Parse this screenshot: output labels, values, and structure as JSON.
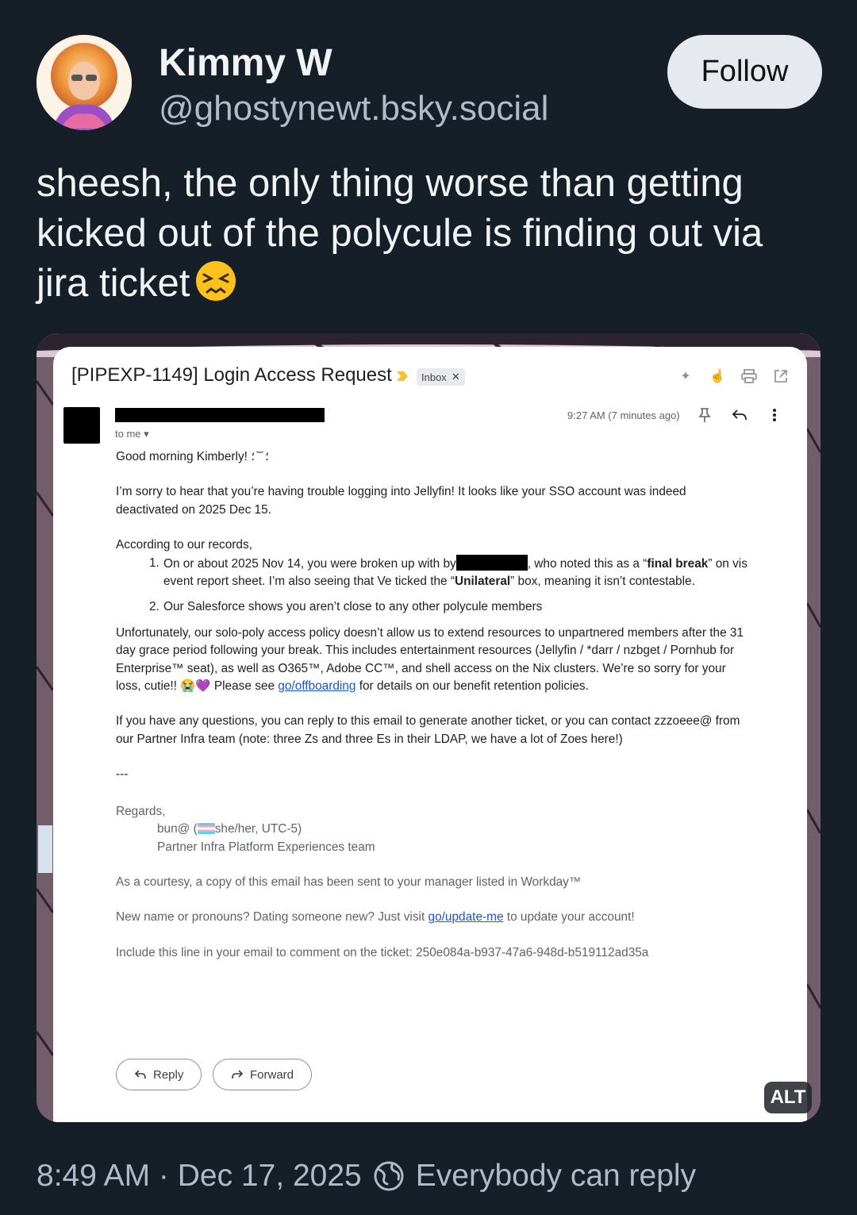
{
  "author": {
    "name": "Kimmy W",
    "handle": "@ghostynewt.bsky.social"
  },
  "follow_label": "Follow",
  "post_text": "sheesh, the only thing worse than getting kicked out of the polycule is finding out via jira ticket",
  "post_emoji": "persevering-face-emoji",
  "email": {
    "subject": "[PIPEXP-1149] Login Access Request",
    "label_chip": "Inbox",
    "to_me": "to me",
    "timestamp": "9:27 AM (7 minutes ago)",
    "greeting": "Good morning Kimberly! ؛ ᷄ ᷅ ؛",
    "p1": "I’m sorry to hear that you’re having trouble logging into Jellyfin! It looks like your SSO account was indeed deactivated on 2025 Dec 15.",
    "records_intro": "According to our records,",
    "item1": {
      "num": "1.",
      "a": "On or about 2025 Nov 14, you were broken up with by",
      "b": ", who noted this as a “",
      "bold1": "final break",
      "c": "” on vis event report sheet. I’m also seeing that Ve ticked the “",
      "bold2": "Unilateral",
      "d": "” box, meaning it isn’t contestable."
    },
    "item2": {
      "num": "2.",
      "text": "Our Salesforce shows you aren’t close to any other polycule members"
    },
    "p2_a": "Unfortunately, our solo-poly access policy doesn’t allow us to extend resources to unpartnered members after the 31 day grace period following your break. This includes entertainment resources (Jellyfin / *darr / nzbget / Pornhub for Enterprise™ seat), as well as O365™, Adobe CC™, and shell access on the Nix clusters. We’re so sorry for your loss, cutie!! 😭💜 Please see ",
    "p2_link": "go/offboarding",
    "p2_b": " for details on our benefit retention policies.",
    "p3": "If you have any questions, you can reply to this email to generate another ticket, or you can contact zzzoeee@ from our Partner Infra team (note: three Zs and three Es in their LDAP, we have a lot of Zoes here!)",
    "separator": "---",
    "regards": "Regards,",
    "sig_a": "bun@ (",
    "sig_b": "she/her, UTC-5)",
    "sig_team": "Partner Infra Platform Experiences team",
    "courtesy": "As a courtesy, a copy of this email has been sent to your manager listed in Workday™",
    "update_a": "New name or pronouns? Dating someone new? Just visit ",
    "update_link": "go/update-me",
    "update_b": " to update your account!",
    "ticket_line": "Include this line in your email to comment on the ticket: 250e084a-b937-47a6-948d-b519112ad35a",
    "reply_label": "Reply",
    "forward_label": "Forward"
  },
  "alt_label": "ALT",
  "footer": {
    "timestamp": "8:49 AM · Dec 17, 2025",
    "reply_setting": "Everybody can reply"
  },
  "colors": {
    "background": "#161e27",
    "handle": "#aebbc9",
    "follow_bg": "#e6e9ee",
    "link": "#1a56c9"
  }
}
